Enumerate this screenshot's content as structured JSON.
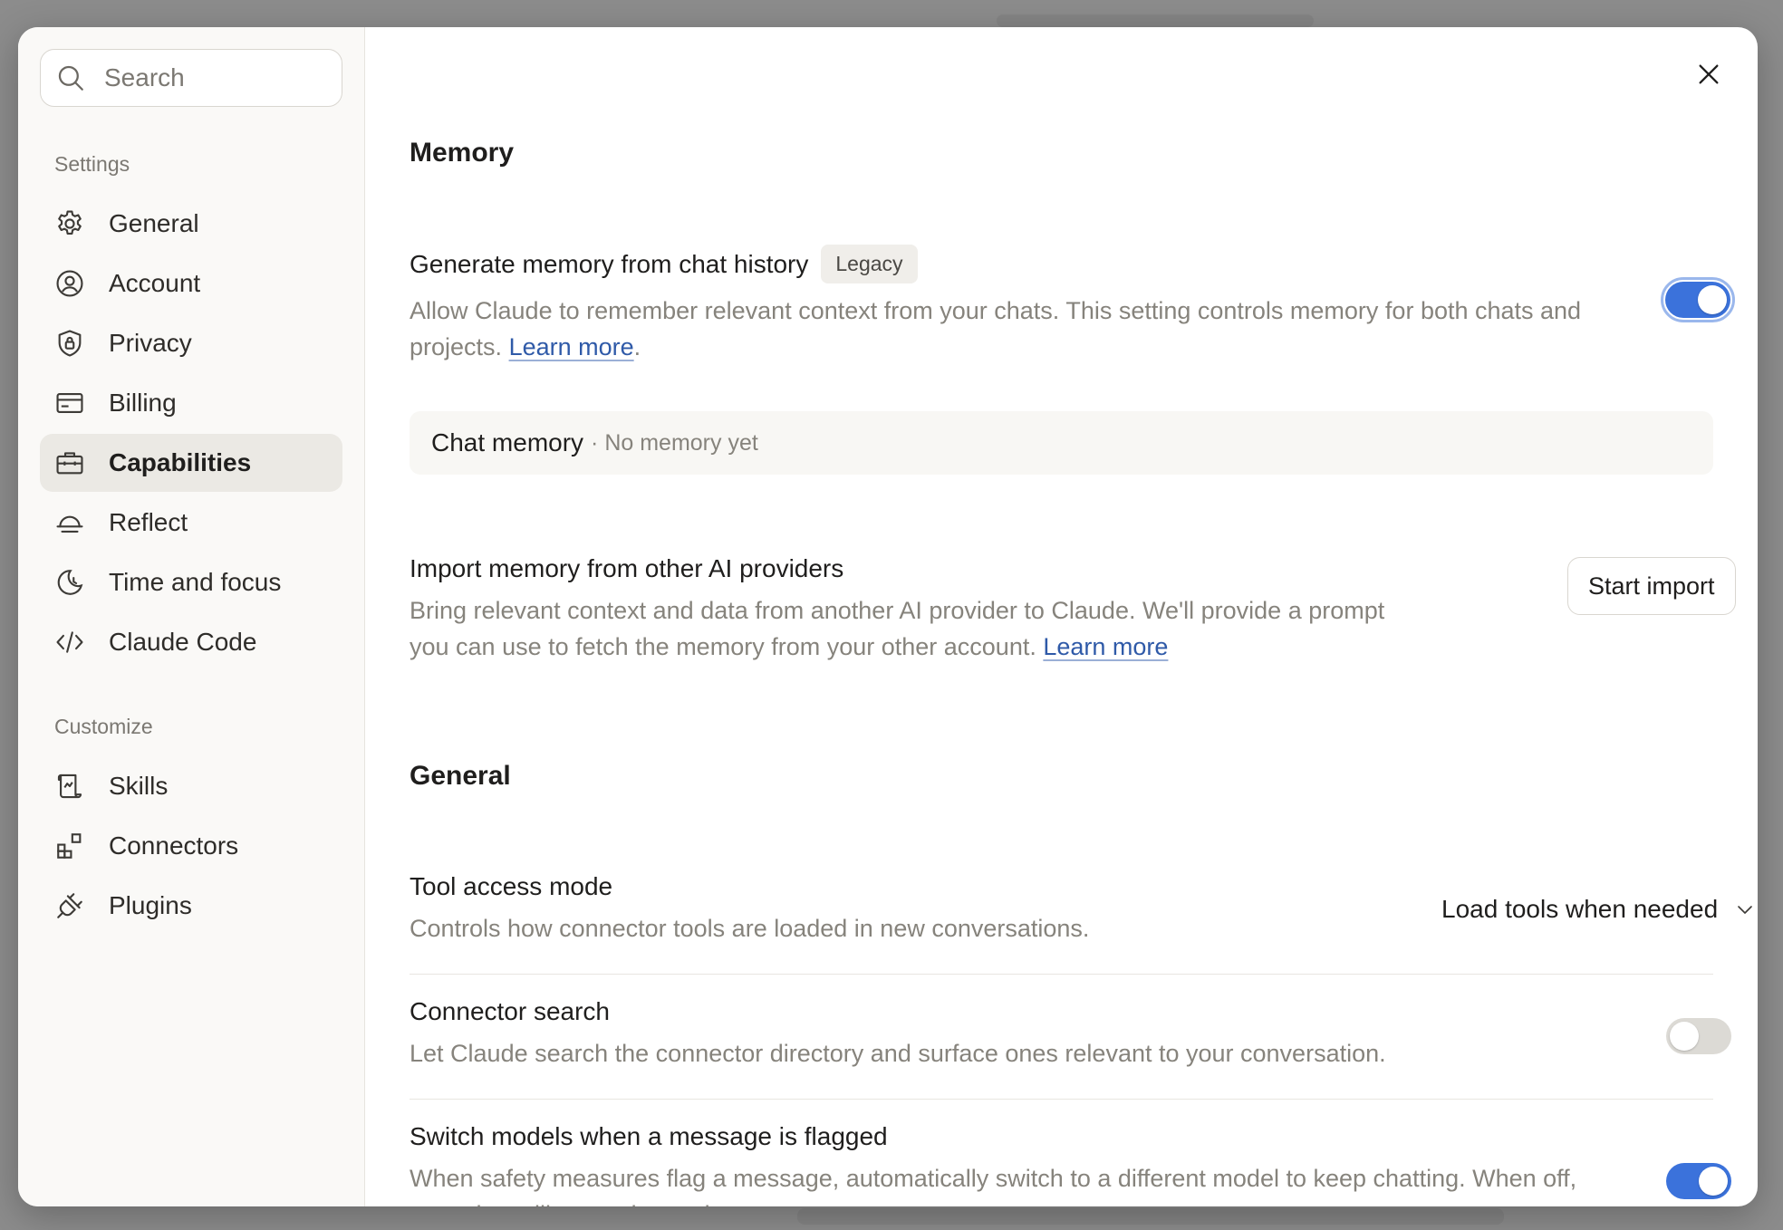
{
  "search": {
    "placeholder": "Search"
  },
  "sidebar": {
    "settings_label": "Settings",
    "settings_items": [
      {
        "label": "General",
        "icon": "gear-icon"
      },
      {
        "label": "Account",
        "icon": "user-circle-icon"
      },
      {
        "label": "Privacy",
        "icon": "shield-lock-icon"
      },
      {
        "label": "Billing",
        "icon": "credit-card-icon"
      },
      {
        "label": "Capabilities",
        "icon": "briefcase-icon",
        "active": true
      },
      {
        "label": "Reflect",
        "icon": "sunrise-icon"
      },
      {
        "label": "Time and focus",
        "icon": "moon-clock-icon"
      },
      {
        "label": "Claude Code",
        "icon": "code-icon"
      }
    ],
    "customize_label": "Customize",
    "customize_items": [
      {
        "label": "Skills",
        "icon": "scroll-icon"
      },
      {
        "label": "Connectors",
        "icon": "blocks-icon"
      },
      {
        "label": "Plugins",
        "icon": "plug-icon"
      }
    ]
  },
  "memory": {
    "heading": "Memory",
    "generate": {
      "title": "Generate memory from chat history",
      "badge": "Legacy",
      "desc": "Allow Claude to remember relevant context from your chats. This setting controls memory for both chats and projects.",
      "link": "Learn more",
      "enabled": true
    },
    "chat_memory": {
      "title": "Chat memory",
      "sub": "· No memory yet"
    },
    "import": {
      "title": "Import memory from other AI providers",
      "desc": "Bring relevant context and data from another AI provider to Claude. We'll provide a prompt you can use to fetch the memory from your other account.",
      "link": "Learn more",
      "button": "Start import"
    }
  },
  "general": {
    "heading": "General",
    "tool_access": {
      "title": "Tool access mode",
      "desc": "Controls how connector tools are loaded in new conversations.",
      "value": "Load tools when needed"
    },
    "connector_search": {
      "title": "Connector search",
      "desc": "Let Claude search the connector directory and surface ones relevant to your conversation.",
      "enabled": false
    },
    "switch_models": {
      "title": "Switch models when a message is flagged",
      "desc": "When safety measures flag a message, automatically switch to a different model to keep chatting. When off, your chat will pause instead.",
      "enabled": true
    }
  },
  "colors": {
    "accent": "#3b72db",
    "link": "#2f5aa8",
    "active_bg": "#ebe9e4"
  }
}
